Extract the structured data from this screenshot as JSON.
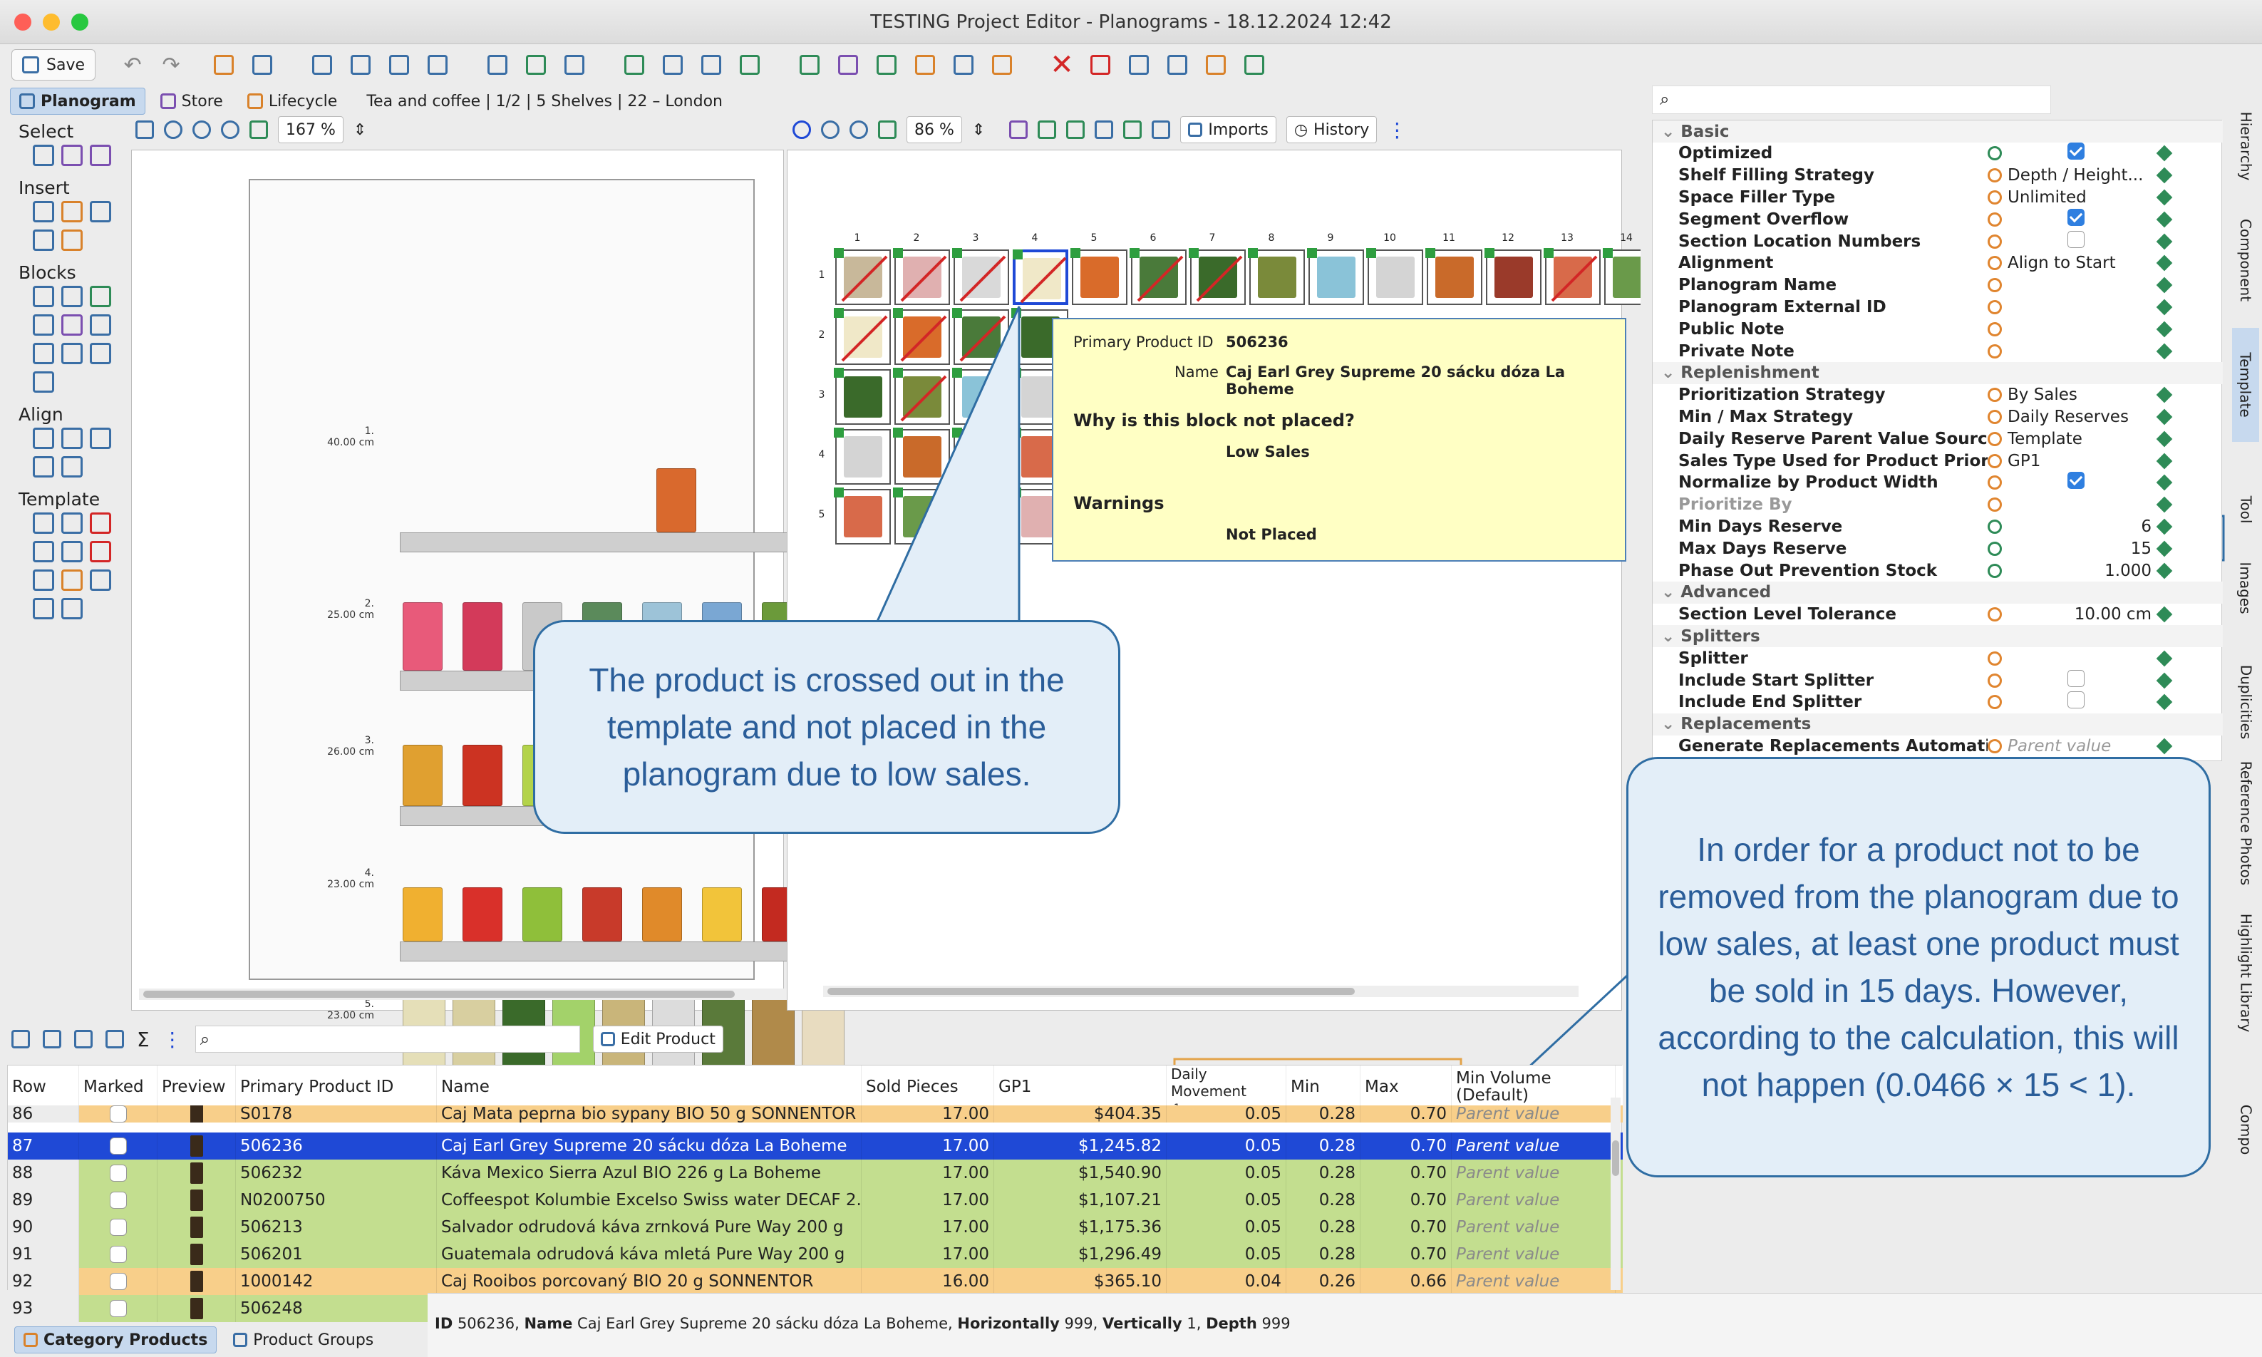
{
  "window": {
    "title": "TESTING Project Editor - Planograms - 18.12.2024 12:42"
  },
  "toolbar": {
    "save_label": "Save"
  },
  "tabs": [
    {
      "label": "Planogram"
    },
    {
      "label": "Store"
    },
    {
      "label": "Lifecycle"
    }
  ],
  "breadcrumb": "Tea and coffee | 1/2 | 5 Shelves | 22 – London",
  "left_panel": {
    "groups": [
      "Select",
      "Insert",
      "Blocks",
      "Align",
      "Template"
    ]
  },
  "planogram_view": {
    "zoom": "167 %",
    "shelves": [
      {
        "num": "1.",
        "height": "40.00 cm"
      },
      {
        "num": "2.",
        "height": "25.00 cm"
      },
      {
        "num": "3.",
        "height": "26.00 cm"
      },
      {
        "num": "4.",
        "height": "23.00 cm"
      },
      {
        "num": "5.",
        "height": "23.00 cm"
      }
    ]
  },
  "template_view": {
    "zoom": "86 %",
    "imports_label": "Imports",
    "history_label": "History",
    "columns": [
      "1",
      "2",
      "3",
      "4",
      "5",
      "6",
      "7",
      "8",
      "9",
      "10",
      "11",
      "12",
      "13",
      "14"
    ],
    "rows": [
      "1",
      "2",
      "3",
      "4",
      "5"
    ]
  },
  "tooltip": {
    "id_label": "Primary Product ID",
    "id_value": "506236",
    "name_label": "Name",
    "name_value": "Caj Earl Grey Supreme 20 sácku dóza La Boheme",
    "why_label": "Why is this block not placed?",
    "why_value": "Low Sales",
    "warnings_label": "Warnings",
    "warnings_value": "Not Placed"
  },
  "callout_left": "The product is crossed out in the template and not placed in the planogram due to low sales.",
  "callout_right": "In order for a product not to be removed from the planogram due to low sales, at least one product must be sold in 15 days. However, according to the calculation, this will not happen (0.0466 × 15 < 1).",
  "properties": {
    "search_placeholder": "",
    "rows": [
      {
        "type": "section",
        "label": "Basic"
      },
      {
        "label": "Optimized",
        "check": true
      },
      {
        "label": "Shelf Filling Strategy",
        "value": "Depth / Height..."
      },
      {
        "label": "Space Filler Type",
        "value": "Unlimited"
      },
      {
        "label": "Segment Overflow",
        "check": true
      },
      {
        "label": "Section Location Numbers",
        "check": false
      },
      {
        "label": "Alignment",
        "value": "Align to Start"
      },
      {
        "label": "Planogram Name",
        "value": ""
      },
      {
        "label": "Planogram External ID",
        "value": ""
      },
      {
        "label": "Public Note",
        "value": ""
      },
      {
        "label": "Private Note",
        "value": ""
      },
      {
        "type": "section",
        "label": "Replenishment"
      },
      {
        "label": "Prioritization Strategy",
        "value": "By Sales"
      },
      {
        "label": "Min / Max Strategy",
        "value": "Daily Reserves"
      },
      {
        "label": "Daily Reserve Parent Value Source",
        "value": "Template"
      },
      {
        "label": "Sales Type Used for Product Priority",
        "value": "GP1"
      },
      {
        "label": "Normalize by Product Width",
        "check": true
      },
      {
        "label": "Prioritize By",
        "value": "",
        "muted": true
      },
      {
        "label": "Min Days Reserve",
        "value": "6",
        "num": true
      },
      {
        "label": "Max Days Reserve",
        "value": "15",
        "num": true
      },
      {
        "label": "Phase Out Prevention Stock",
        "value": "1.000",
        "num": true
      },
      {
        "type": "section",
        "label": "Advanced"
      },
      {
        "label": "Section Level Tolerance",
        "value": "10.00 cm",
        "num": true
      },
      {
        "type": "section",
        "label": "Splitters"
      },
      {
        "label": "Splitter",
        "value": ""
      },
      {
        "label": "Include Start Splitter",
        "check": false
      },
      {
        "label": "Include End Splitter",
        "check": false
      },
      {
        "type": "section",
        "label": "Replacements"
      },
      {
        "label": "Generate Replacements Automatica...",
        "value": "Parent value",
        "italic": true
      }
    ]
  },
  "side_tabs": [
    "Hierarchy",
    "Component",
    "Template",
    "Tool",
    "Images",
    "Duplicities",
    "Reference Photos",
    "Highlight Library",
    "Compo"
  ],
  "bottom": {
    "edit_product_label": "Edit Product",
    "search_placeholder": "",
    "headers": [
      "Row",
      "Marked",
      "Preview",
      "Primary Product ID",
      "Name",
      "Sold Pieces",
      "GP1",
      "Daily Movement",
      "Min",
      "Max",
      "Min Volume (Default)"
    ],
    "sort_indicator": "1",
    "rows": [
      {
        "row": "86",
        "id": "S0178",
        "name": "Caj Mata peprna bio sypany BIO 50 g SONNENTOR",
        "sold": "17.00",
        "gp1": "$404.35",
        "daily": "0.05",
        "min": "0.28",
        "max": "0.70",
        "vol": "Parent value",
        "style": "orange"
      },
      {
        "row": "87",
        "id": "506236",
        "name": "Caj Earl Grey Supreme 20 sácku dóza La Boheme",
        "sold": "17.00",
        "gp1": "$1,245.82",
        "daily": "0.05",
        "min": "0.28",
        "max": "0.70",
        "vol": "Parent value",
        "style": "selected"
      },
      {
        "row": "88",
        "id": "506232",
        "name": "Káva Mexico Sierra Azul BIO 226 g La Boheme",
        "sold": "17.00",
        "gp1": "$1,540.90",
        "daily": "0.05",
        "min": "0.28",
        "max": "0.70",
        "vol": "Parent value",
        "style": "green"
      },
      {
        "row": "89",
        "id": "N0200750",
        "name": "Coffeespot Kolumbie Excelso Swiss water DECAF 2...",
        "sold": "17.00",
        "gp1": "$1,107.21",
        "daily": "0.05",
        "min": "0.28",
        "max": "0.70",
        "vol": "Parent value",
        "style": "green"
      },
      {
        "row": "90",
        "id": "506213",
        "name": "Salvador odrudová káva zrnková Pure Way 200 g",
        "sold": "17.00",
        "gp1": "$1,175.36",
        "daily": "0.05",
        "min": "0.28",
        "max": "0.70",
        "vol": "Parent value",
        "style": "green"
      },
      {
        "row": "91",
        "id": "506201",
        "name": "Guatemala odrudová káva mletá Pure Way 200 g",
        "sold": "17.00",
        "gp1": "$1,296.49",
        "daily": "0.05",
        "min": "0.28",
        "max": "0.70",
        "vol": "Parent value",
        "style": "green"
      },
      {
        "row": "92",
        "id": "1000142",
        "name": "Caj Rooibos porcovaný BIO 20 g SONNENTOR",
        "sold": "16.00",
        "gp1": "$365.10",
        "daily": "0.04",
        "min": "0.26",
        "max": "0.66",
        "vol": "Parent value",
        "style": "orange"
      },
      {
        "row": "93",
        "id": "506248",
        "name": "",
        "sold": "",
        "gp1": "",
        "daily": "",
        "min": "",
        "max": "",
        "vol": "",
        "style": "green"
      }
    ]
  },
  "bottom_tabs": [
    "Category Products",
    "Product Groups"
  ],
  "status": {
    "id_label": "ID",
    "id": "506236",
    "name_label": "Name",
    "name": "Caj Earl Grey Supreme 20 sácku dóza La Boheme",
    "h_label": "Horizontally",
    "h": "999",
    "v_label": "Vertically",
    "v": "1",
    "d_label": "Depth",
    "d": "999"
  },
  "colors": {
    "accent": "#2f6da3",
    "selected_row": "#1f49d6",
    "green_row": "#c3de8f",
    "orange_row": "#f8cf8a",
    "tooltip_bg": "#ffffc4"
  }
}
